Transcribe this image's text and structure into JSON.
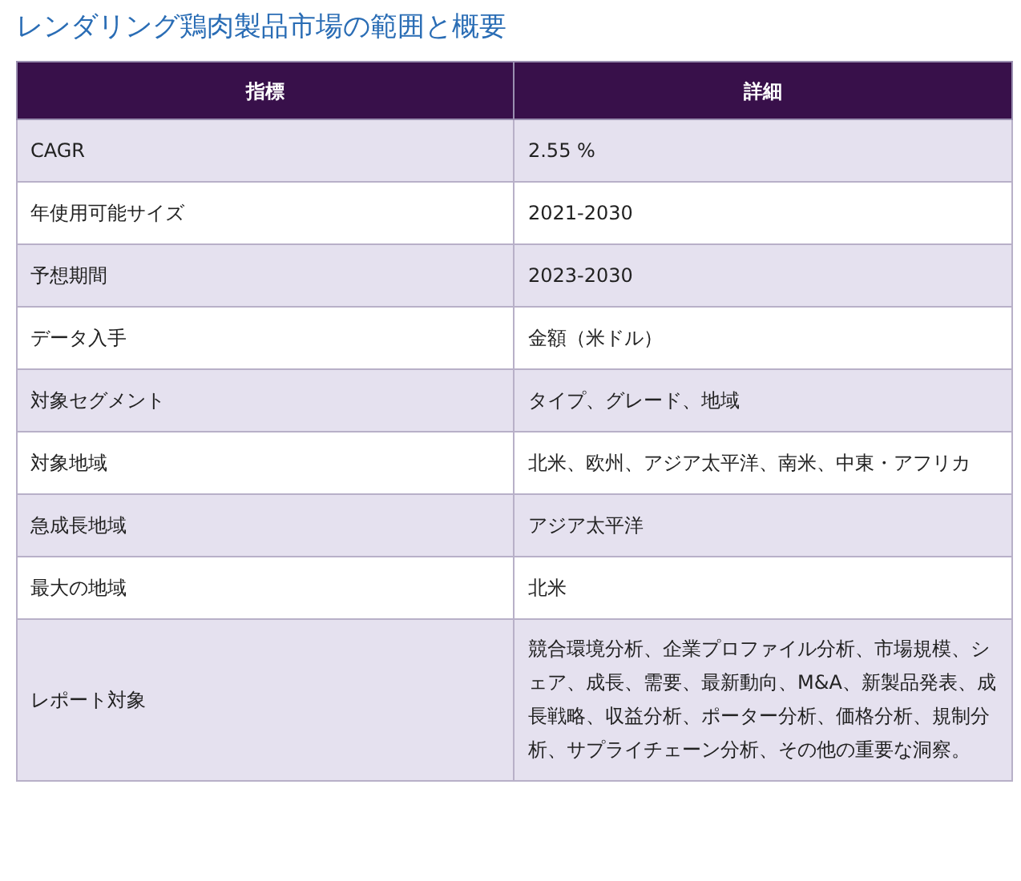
{
  "title": "レンダリング鶏肉製品市場の範囲と概要",
  "table": {
    "columns": [
      "指標",
      "詳細"
    ],
    "rows": [
      {
        "label": "CAGR",
        "value": "2.55 %"
      },
      {
        "label": "年使用可能サイズ",
        "value": "2021-2030"
      },
      {
        "label": "予想期間",
        "value": "2023-2030"
      },
      {
        "label": "データ入手",
        "value": "金額（米ドル）"
      },
      {
        "label": "対象セグメント",
        "value": "タイプ、グレード、地域"
      },
      {
        "label": "対象地域",
        "value": "北米、欧州、アジア太平洋、南米、中東・アフリカ"
      },
      {
        "label": "急成長地域",
        "value": "アジア太平洋"
      },
      {
        "label": "最大の地域",
        "value": "北米"
      },
      {
        "label": "レポート対象",
        "value": "競合環境分析、企業プロファイル分析、市場規模、シェア、成長、需要、最新動向、M&A、新製品発表、成長戦略、収益分析、ポーター分析、価格分析、規制分析、サプライチェーン分析、その他の重要な洞察。"
      }
    ]
  }
}
